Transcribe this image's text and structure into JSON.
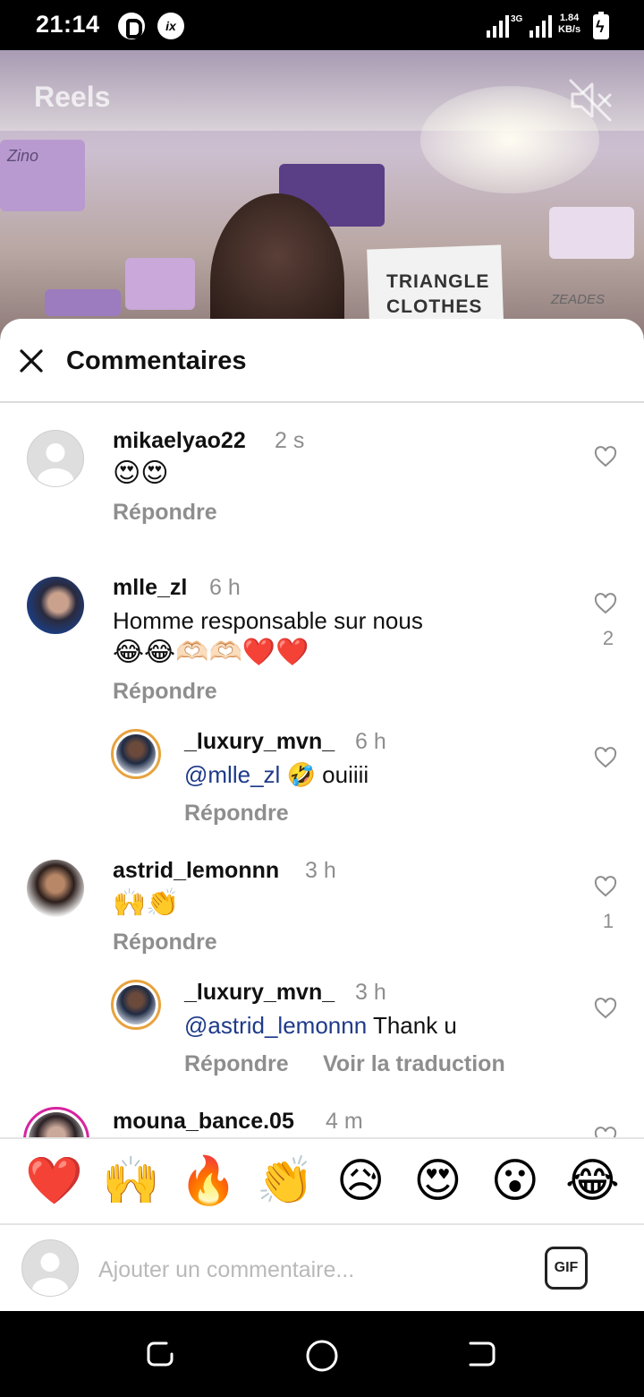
{
  "status_bar": {
    "time": "21:14",
    "network": "3G",
    "speed_value": "1.84",
    "speed_unit": "KB/s",
    "app_icon_2_label": "ix"
  },
  "video": {
    "title": "Reels",
    "board_line1": "TRIANGLE",
    "board_line2": "CLOTHES",
    "brand_1": "Zino",
    "brand_2": "ZEADES"
  },
  "sheet": {
    "title": "Commentaires"
  },
  "comments": [
    {
      "user": "mikaelyao22",
      "time": "2 s",
      "text": "😍😍",
      "reply_label": "Répondre",
      "likes": ""
    },
    {
      "user": "mlle_zl",
      "time": "6 h",
      "text_line1": "Homme responsable sur nous",
      "text_line2": "😂😂🫶🏻🫶🏻❤️❤️",
      "reply_label": "Répondre",
      "likes": "2"
    },
    {
      "user": "_luxury_mvn_",
      "time": "6 h",
      "mention": "@mlle_zl",
      "text": "🤣 ouiiii",
      "reply_label": "Répondre",
      "likes": ""
    },
    {
      "user": "astrid_lemonnn",
      "time": "3 h",
      "text": "🙌👏",
      "reply_label": "Répondre",
      "likes": "1"
    },
    {
      "user": "_luxury_mvn_",
      "time": "3 h",
      "mention": "@astrid_lemonnn",
      "text": "Thank u",
      "reply_label": "Répondre",
      "translate_label": "Voir la traduction",
      "likes": ""
    },
    {
      "user": "mouna_bance.05",
      "time": "4 m"
    }
  ],
  "reactions": [
    "❤️",
    "🙌",
    "🔥",
    "👏",
    "😥",
    "😍",
    "😮",
    "😂"
  ],
  "composer": {
    "placeholder": "Ajouter un commentaire...",
    "gif_label": "GIF"
  },
  "colors": {
    "mention": "#1e3a8a",
    "story_ring": "#d6249f",
    "muted_text": "#8e8e8e"
  }
}
